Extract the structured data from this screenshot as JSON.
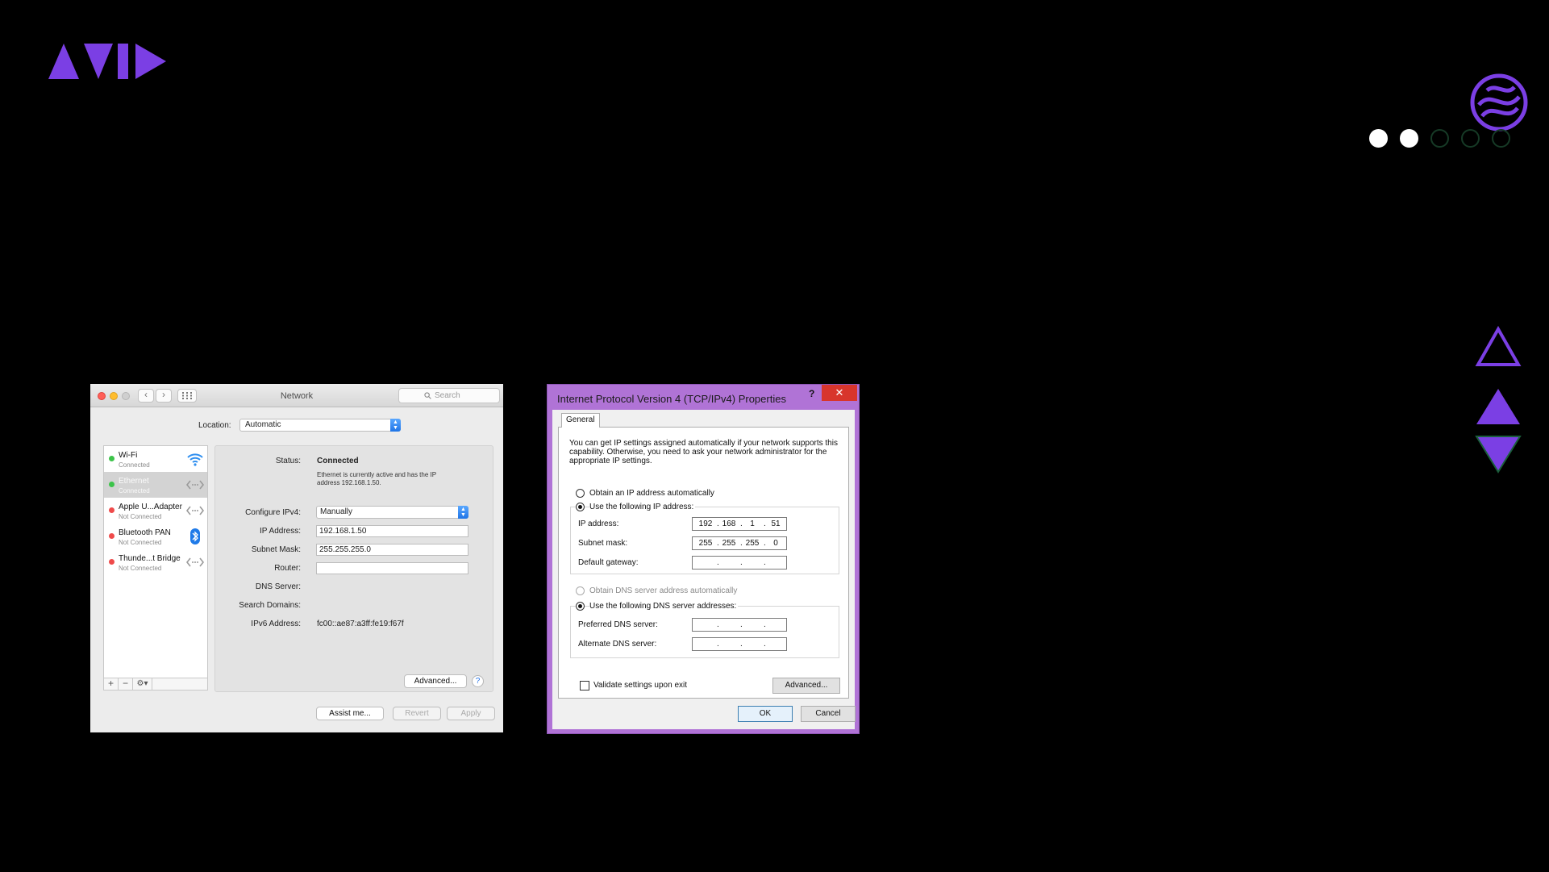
{
  "slide": {
    "progress": {
      "total": 5,
      "current": 2
    }
  },
  "mac_window": {
    "title": "Network",
    "search_placeholder": "Search",
    "location_label": "Location:",
    "location_value": "Automatic",
    "services": [
      {
        "name": "Wi-Fi",
        "status": "Connected",
        "dot": "green",
        "icon": "wifi-icon"
      },
      {
        "name": "Ethernet",
        "status": "Connected",
        "dot": "green",
        "icon": "ethernet-icon"
      },
      {
        "name": "Apple U...Adapter",
        "status": "Not Connected",
        "dot": "red",
        "icon": "ethernet-icon"
      },
      {
        "name": "Bluetooth PAN",
        "status": "Not Connected",
        "dot": "red",
        "icon": "bluetooth-icon"
      },
      {
        "name": "Thunde...t Bridge",
        "status": "Not Connected",
        "dot": "red",
        "icon": "ethernet-icon"
      }
    ],
    "detail": {
      "status_label": "Status:",
      "status_value": "Connected",
      "status_description": "Ethernet is currently active and has the IP address 192.168.1.50.",
      "configure_label": "Configure IPv4:",
      "configure_value": "Manually",
      "ip_label": "IP Address:",
      "ip_value": "192.168.1.50",
      "subnet_label": "Subnet Mask:",
      "subnet_value": "255.255.255.0",
      "router_label": "Router:",
      "router_value": "",
      "dns_label": "DNS Server:",
      "search_domains_label": "Search Domains:",
      "ipv6_label": "IPv6 Address:",
      "ipv6_value": "fc00::ae87:a3ff:fe19:f67f",
      "advanced_label": "Advanced...",
      "help_label": "?"
    },
    "buttons": {
      "assist": "Assist me...",
      "revert": "Revert",
      "apply": "Apply"
    }
  },
  "win_dialog": {
    "title": "Internet Protocol Version 4 (TCP/IPv4) Properties",
    "help": "?",
    "close": "✕",
    "tab": "General",
    "intro": "You can get IP settings assigned automatically if your network supports this capability. Otherwise, you need to ask your network administrator for the appropriate IP settings.",
    "radio_auto_ip": "Obtain an IP address automatically",
    "radio_manual_ip": "Use the following IP address:",
    "ip_label": "IP address:",
    "ip": [
      "192",
      "168",
      "1",
      "51"
    ],
    "subnet_label": "Subnet mask:",
    "subnet": [
      "255",
      "255",
      "255",
      "0"
    ],
    "gateway_label": "Default gateway:",
    "gateway": [
      "",
      "",
      "",
      ""
    ],
    "radio_auto_dns": "Obtain DNS server address automatically",
    "radio_manual_dns": "Use the following DNS server addresses:",
    "pref_dns_label": "Preferred DNS server:",
    "pref_dns": [
      "",
      "",
      "",
      ""
    ],
    "alt_dns_label": "Alternate DNS server:",
    "alt_dns": [
      "",
      "",
      "",
      ""
    ],
    "validate_label": "Validate settings upon exit",
    "advanced": "Advanced...",
    "ok": "OK",
    "cancel": "Cancel"
  },
  "colors": {
    "brand_purple": "#7b3fe4",
    "dialog_frame": "#b073d6",
    "close_red": "#d8352c",
    "status_green": "#3cc44a",
    "status_red": "#ef4a4a"
  }
}
